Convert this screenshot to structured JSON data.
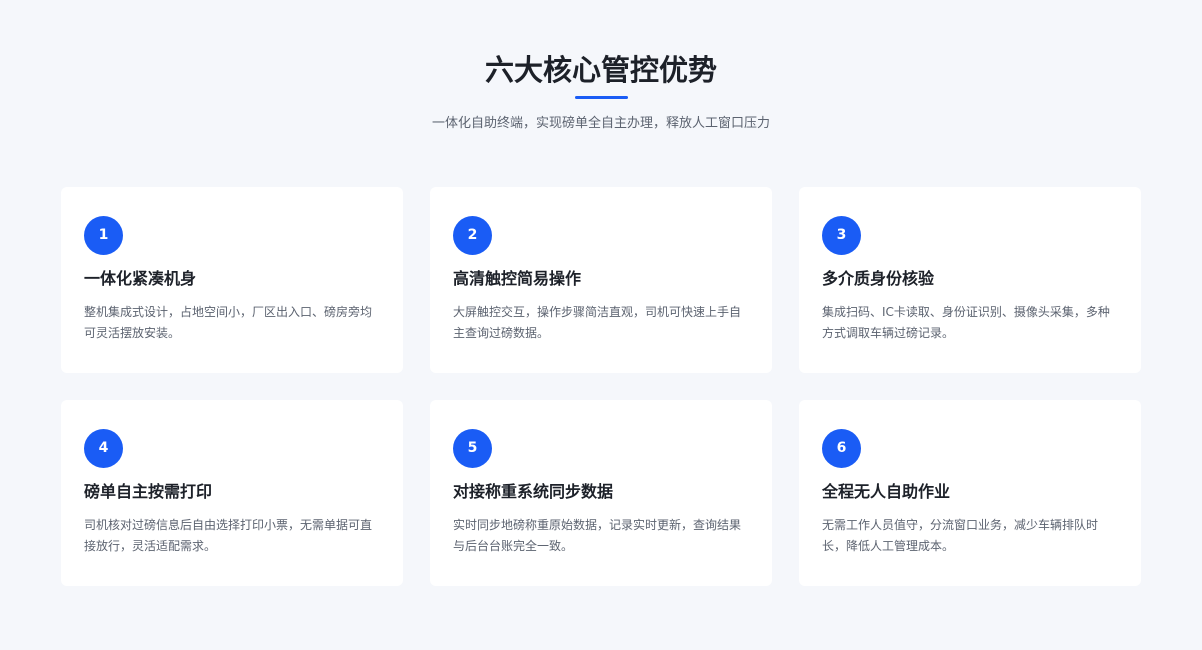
{
  "header": {
    "title": "六大核心管控优势",
    "subtitle": "一体化自助终端，实现磅单全自主办理，释放人工窗口压力"
  },
  "colors": {
    "accent": "#1a5cf5",
    "background": "#f5f7fb",
    "card": "#ffffff",
    "title_text": "#1d2129",
    "body_text": "#5c6370"
  },
  "cards": [
    {
      "number": "1",
      "title": "一体化紧凑机身",
      "description": "整机集成式设计，占地空间小，厂区出入口、磅房旁均可灵活摆放安装。"
    },
    {
      "number": "2",
      "title": "高清触控简易操作",
      "description": "大屏触控交互，操作步骤简洁直观，司机可快速上手自主查询过磅数据。"
    },
    {
      "number": "3",
      "title": "多介质身份核验",
      "description": "集成扫码、IC卡读取、身份证识别、摄像头采集，多种方式调取车辆过磅记录。"
    },
    {
      "number": "4",
      "title": "磅单自主按需打印",
      "description": "司机核对过磅信息后自由选择打印小票，无需单据可直接放行，灵活适配需求。"
    },
    {
      "number": "5",
      "title": "对接称重系统同步数据",
      "description": "实时同步地磅称重原始数据，记录实时更新，查询结果与后台台账完全一致。"
    },
    {
      "number": "6",
      "title": "全程无人自助作业",
      "description": "无需工作人员值守，分流窗口业务，减少车辆排队时长，降低人工管理成本。"
    }
  ]
}
